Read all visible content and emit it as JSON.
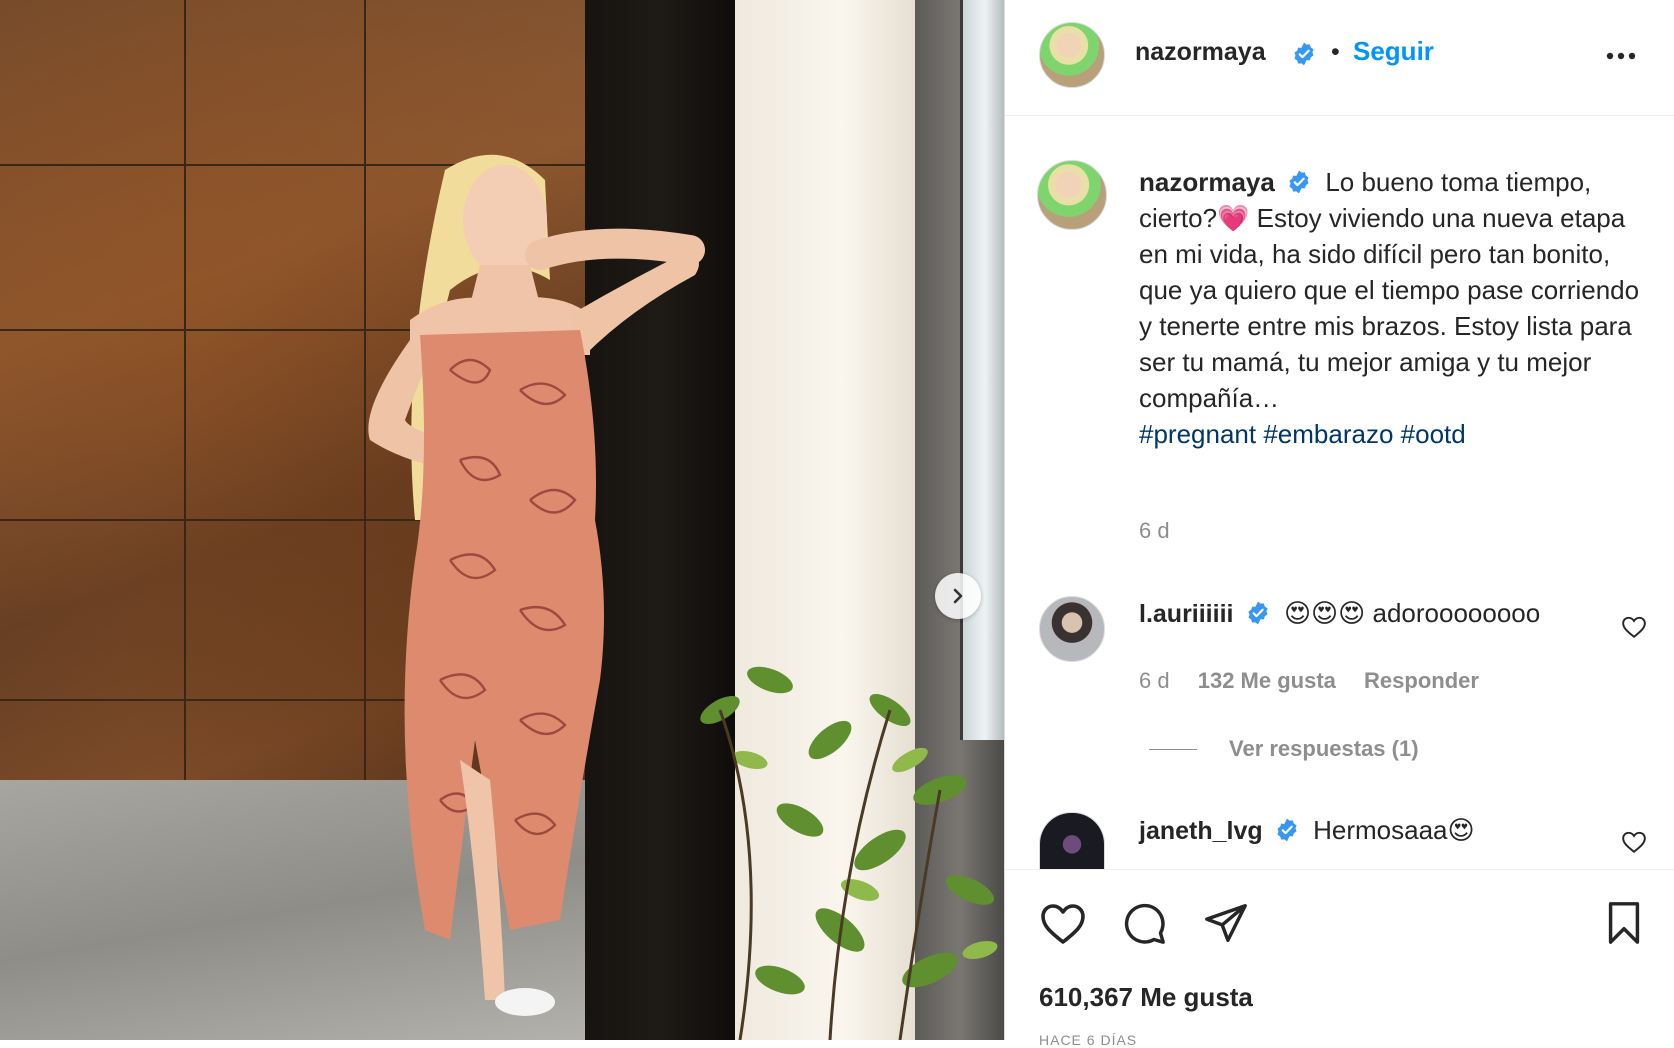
{
  "post": {
    "username": "nazormaya",
    "follow_label": "Seguir",
    "header_separator": "•",
    "caption_text": "Lo bueno toma tiempo, cierto?💗 Estoy viviendo una nueva etapa en mi vida, ha sido difícil pero tan bonito, que ya quiero que el tiempo pase corriendo y tenerte entre mis brazos. Estoy lista para ser tu mamá, tu mejor amiga y tu mejor compañía…",
    "hashtags": [
      "#pregnant",
      "#embarazo",
      "#ootd"
    ],
    "caption_time": "6 d",
    "likes": "610,367 Me gusta",
    "date_partial": "HACE 6 DÍAS"
  },
  "comments": [
    {
      "username": "l.auriiiiii",
      "text": "😍😍😍 adoroooooooo",
      "time": "6 d",
      "likes": "132 Me gusta",
      "reply_label": "Responder",
      "view_replies": "Ver respuestas (1)"
    },
    {
      "username": "janeth_lvg",
      "text": "Hermosaaa😍"
    }
  ],
  "icons": {
    "verified": "verified-badge-icon",
    "more": "more-options-icon",
    "next": "chevron-right-icon",
    "like": "heart-icon",
    "comment": "comment-icon",
    "share": "share-icon",
    "save": "bookmark-icon"
  },
  "colors": {
    "accent": "#0095f6",
    "hashtag": "#00376b",
    "muted": "#8e8e8e",
    "text": "#262626"
  }
}
